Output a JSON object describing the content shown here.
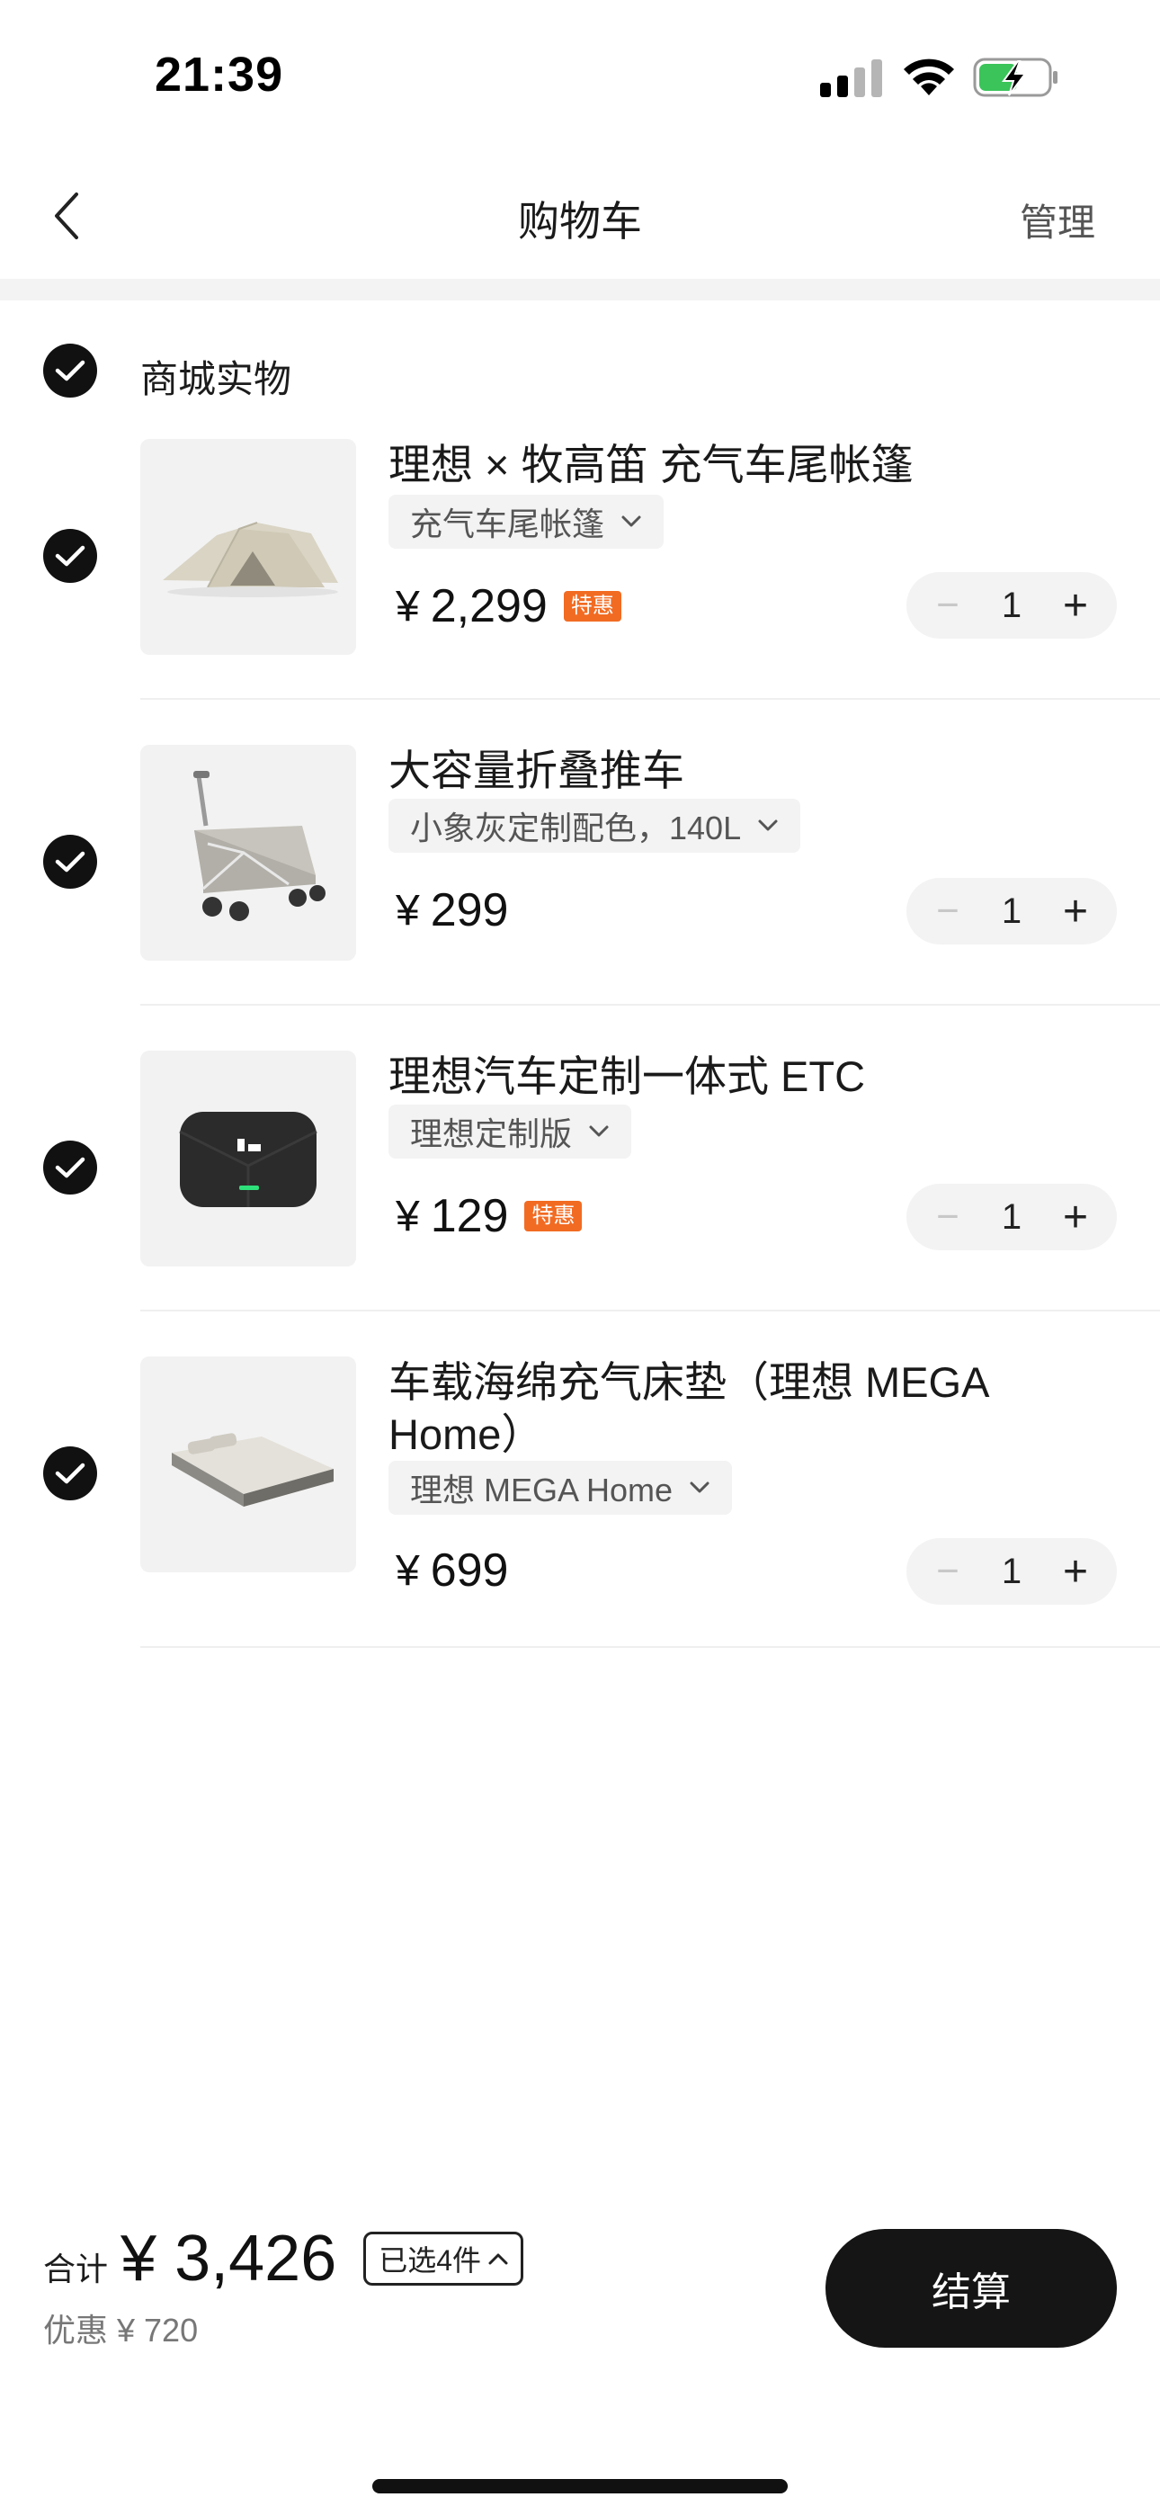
{
  "status_bar": {
    "time": "21:39"
  },
  "nav": {
    "title": "购物车",
    "manage": "管理"
  },
  "group": {
    "label": "商城实物"
  },
  "items": [
    {
      "name": "理想 × 牧高笛 充气车尾帐篷",
      "spec": "充气车尾帐篷",
      "currency": "¥",
      "price": "2,299",
      "badge": "特惠",
      "qty": "1",
      "image": "tent"
    },
    {
      "name": "大容量折叠推车",
      "spec": "小象灰定制配色，140L",
      "currency": "¥",
      "price": "299",
      "badge": "",
      "qty": "1",
      "image": "wagon"
    },
    {
      "name": "理想汽车定制一体式 ETC",
      "spec": "理想定制版",
      "currency": "¥",
      "price": "129",
      "badge": "特惠",
      "qty": "1",
      "image": "etc-device"
    },
    {
      "name": "车载海绵充气床垫（理想 MEGA Home）",
      "spec": "理想 MEGA Home",
      "currency": "¥",
      "price": "699",
      "badge": "",
      "qty": "1",
      "image": "mattress"
    }
  ],
  "stepper": {
    "minus": "−",
    "plus": "+"
  },
  "summary": {
    "total_label": "合计",
    "total_amount": "¥ 3,426",
    "selected": "已选4件",
    "discount": "优惠 ¥ 720"
  },
  "checkout": {
    "label": "结算"
  }
}
